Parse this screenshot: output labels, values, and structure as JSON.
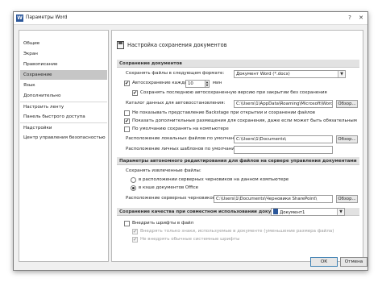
{
  "window": {
    "title": "Параметры Word",
    "help_glyph": "?",
    "close_glyph": "✕",
    "app_icon_letter": "W"
  },
  "sidebar": {
    "items": [
      {
        "label": "Общие"
      },
      {
        "label": "Экран"
      },
      {
        "label": "Правописание"
      },
      {
        "label": "Сохранение"
      },
      {
        "label": "Язык"
      },
      {
        "label": "Дополнительно"
      },
      {
        "label": "Настроить ленту"
      },
      {
        "label": "Панель быстрого доступа"
      },
      {
        "label": "Надстройки"
      },
      {
        "label": "Центр управления безопасностью"
      }
    ],
    "selected": "Сохранение"
  },
  "main": {
    "header": "Настройка сохранения документов",
    "sections": {
      "save_docs": "Сохранение документов",
      "server": "Параметры автономного редактирования для файлов на сервере управления документами",
      "fidelity": "Сохранение качества при совместном использовании документа:"
    },
    "save_format_label": "Сохранять файлы в следующем формате:",
    "save_format_value": "Документ Word (*.docx)",
    "autosave_label": "Автосохранение каждые",
    "autosave_minutes": "10",
    "autosave_unit": "мин",
    "keep_last_label": "Сохранять последнюю автосохраненную версию при закрытии без сохранения",
    "autorecover_label": "Каталог данных для автовосстановления:",
    "autorecover_path": "C:\\Users\\1\\AppData\\Roaming\\Microsoft\\Word\\",
    "browse_label": "Обзор...",
    "no_backstage_label": "Не показывать представление Backstage при открытии и сохранении файлов",
    "show_additional_label": "Показать дополнительные размещения для сохранения, даже если может быть обязательным",
    "default_computer_label": "По умолчанию сохранять на компьютере",
    "local_location_label": "Расположение локальных файлов по умолчанию:",
    "local_location_path": "C:\\Users\\1\\Documents\\",
    "templates_location_label": "Расположение личных шаблонов по умолчанию:",
    "checked_out_label": "Сохранять извлеченные файлы:",
    "radio_server_drafts": "в расположении серверных черновиков на данном компьютере",
    "radio_office_cache": "в кэше документов Office",
    "server_drafts_label": "Расположение серверных черновиков:",
    "server_drafts_path": "C:\\Users\\1\\Documents\\Черновики SharePoint\\",
    "fidelity_doc": "Документ1",
    "embed_fonts_label": "Внедрить шрифты в файл",
    "embed_used_only_label": "Внедрять только знаки, используемые в документе (уменьшение размера файла)",
    "no_system_fonts_label": "Не внедрять обычные системные шрифты"
  },
  "footer": {
    "ok_label": "ОК",
    "cancel_label": "Отмена"
  },
  "icons": {
    "checkmark": "✔",
    "dropdown": "▼",
    "spin_up": "▲",
    "spin_down": "▼"
  },
  "colors": {
    "selected_nav": "#c6c6c6",
    "section_band": "#e2e2e2",
    "word_blue": "#2b579a"
  }
}
